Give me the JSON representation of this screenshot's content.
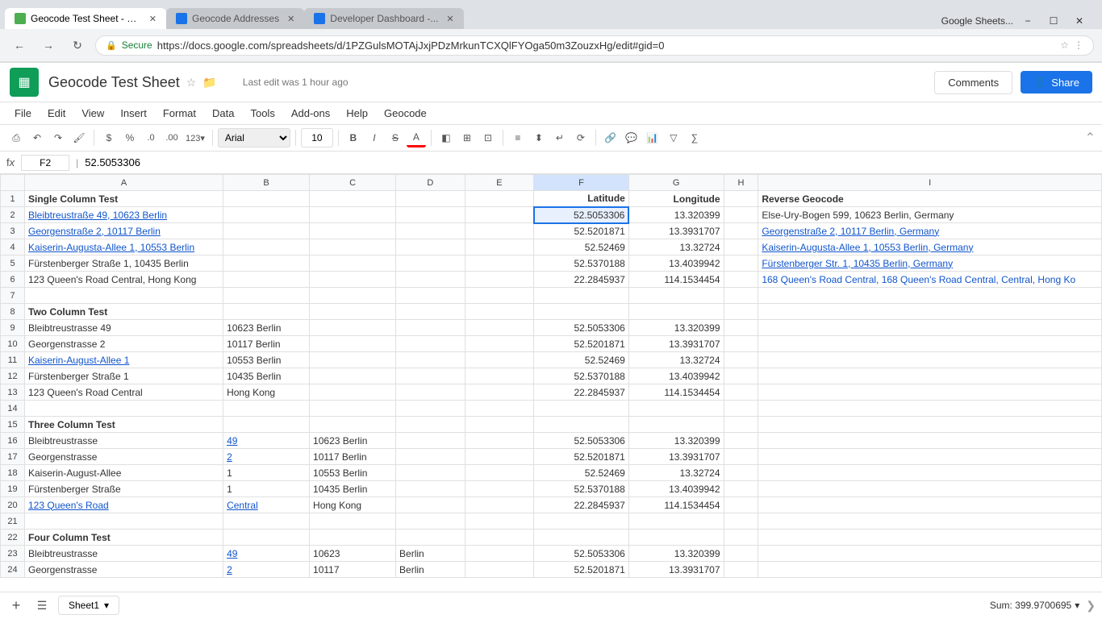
{
  "browser": {
    "tabs": [
      {
        "id": "tab1",
        "label": "Geocode Test Sheet - Go...",
        "favicon_color": "green",
        "active": true
      },
      {
        "id": "tab2",
        "label": "Geocode Addresses",
        "favicon_color": "blue",
        "active": false
      },
      {
        "id": "tab3",
        "label": "Developer Dashboard -...",
        "favicon_color": "blue",
        "active": false
      }
    ],
    "address": "https://docs.google.com/spreadsheets/d/1PZGulsMOTAjJxjPDzMrkunTCXQlFYOga50m3ZouzxHg/edit#gid=0",
    "secure_label": "Secure",
    "brand_label": "Google Sheets...",
    "window_controls": [
      "−",
      "☐",
      "✕"
    ]
  },
  "app": {
    "icon_char": "▦",
    "title": "Geocode Test Sheet",
    "last_edit": "Last edit was 1 hour ago",
    "comments_label": "Comments",
    "share_label": "Share"
  },
  "menu": {
    "items": [
      "File",
      "Edit",
      "View",
      "Insert",
      "Format",
      "Data",
      "Tools",
      "Add-ons",
      "Help",
      "Geocode"
    ]
  },
  "toolbar": {
    "print": "⎙",
    "undo": "↶",
    "redo": "↷",
    "paint": "🖌",
    "currency": "$",
    "percent": "%",
    "decimal_dec": ".0",
    "decimal_inc": ".00",
    "number_format": "123 ▾",
    "font_family": "Arial",
    "font_size": "10",
    "bold": "B",
    "italic": "I",
    "strikethrough": "S̶",
    "font_color": "A",
    "fill_color": "◧",
    "borders": "⊞",
    "merge": "⊡",
    "align_h": "≡",
    "align_v": "⬍",
    "text_wrap": "↵",
    "text_rotate": "⟳",
    "link": "🔗",
    "comment": "💬",
    "chart": "📊",
    "filter": "▽",
    "function": "∑",
    "collapse": "⌃"
  },
  "formula_bar": {
    "cell_ref": "F2",
    "value": "52.5053306"
  },
  "columns": {
    "headers": [
      "",
      "A",
      "B",
      "C",
      "D",
      "E",
      "F",
      "G",
      "H",
      "I"
    ]
  },
  "rows": [
    {
      "row": 1,
      "a": "Single Column Test",
      "b": "",
      "c": "",
      "d": "",
      "e": "",
      "f": "Latitude",
      "g": "Longitude",
      "h": "",
      "i": "Reverse Geocode",
      "bold": true
    },
    {
      "row": 2,
      "a": "Bleibtreustraße 49, 10623 Berlin",
      "b": "",
      "c": "",
      "d": "",
      "e": "",
      "f": "52.5053306",
      "g": "13.320399",
      "h": "",
      "i": "Else-Ury-Bogen 599, 10623 Berlin, Germany",
      "a_blue": true,
      "selected_f": true
    },
    {
      "row": 3,
      "a": "Georgenstraße 2, 10117 Berlin",
      "b": "",
      "c": "",
      "d": "",
      "e": "",
      "f": "52.5201871",
      "g": "13.3931707",
      "h": "",
      "i": "Georgenstraße 2, 10117 Berlin, Germany",
      "a_blue": true,
      "i_blue": true
    },
    {
      "row": 4,
      "a": "Kaiserin-Augusta-Allee 1, 10553 Berlin",
      "b": "",
      "c": "",
      "d": "",
      "e": "",
      "f": "52.52469",
      "g": "13.32724",
      "h": "",
      "i": "Kaiserin-Augusta-Allee 1, 10553 Berlin, Germany",
      "a_blue": true,
      "i_blue": true
    },
    {
      "row": 5,
      "a": "Fürstenberger Straße 1, 10435 Berlin",
      "b": "",
      "c": "",
      "d": "",
      "e": "",
      "f": "52.5370188",
      "g": "13.4039942",
      "h": "",
      "i": "Fürstenberger Str. 1, 10435 Berlin, Germany",
      "i_blue": true
    },
    {
      "row": 6,
      "a": "123 Queen's Road Central, Hong Kong",
      "b": "",
      "c": "",
      "d": "",
      "e": "",
      "f": "22.2845937",
      "g": "114.1534454",
      "h": "",
      "i": "168 Queen's Road Central, 168 Queen's Road Central, Central, Hong Ko"
    },
    {
      "row": 7,
      "a": "",
      "b": "",
      "c": "",
      "d": "",
      "e": "",
      "f": "",
      "g": "",
      "h": "",
      "i": ""
    },
    {
      "row": 8,
      "a": "Two Column Test",
      "b": "",
      "c": "",
      "d": "",
      "e": "",
      "f": "",
      "g": "",
      "h": "",
      "i": "",
      "bold": true
    },
    {
      "row": 9,
      "a": "Bleibtreustrasse 49",
      "b": "10623 Berlin",
      "c": "",
      "d": "",
      "e": "",
      "f": "52.5053306",
      "g": "13.320399",
      "h": "",
      "i": ""
    },
    {
      "row": 10,
      "a": "Georgenstrasse 2",
      "b": "10117 Berlin",
      "c": "",
      "d": "",
      "e": "",
      "f": "52.5201871",
      "g": "13.3931707",
      "h": "",
      "i": ""
    },
    {
      "row": 11,
      "a": "Kaiserin-August-Allee 1",
      "b": "10553 Berlin",
      "c": "",
      "d": "",
      "e": "",
      "f": "52.52469",
      "g": "13.32724",
      "h": "",
      "i": "",
      "a_blue": true
    },
    {
      "row": 12,
      "a": "Fürstenberger Straße 1",
      "b": "10435 Berlin",
      "c": "",
      "d": "",
      "e": "",
      "f": "52.5370188",
      "g": "13.4039942",
      "h": "",
      "i": ""
    },
    {
      "row": 13,
      "a": "123 Queen's Road Central",
      "b": "Hong Kong",
      "c": "",
      "d": "",
      "e": "",
      "f": "22.2845937",
      "g": "114.1534454",
      "h": "",
      "i": ""
    },
    {
      "row": 14,
      "a": "",
      "b": "",
      "c": "",
      "d": "",
      "e": "",
      "f": "",
      "g": "",
      "h": "",
      "i": ""
    },
    {
      "row": 15,
      "a": "Three Column Test",
      "b": "",
      "c": "",
      "d": "",
      "e": "",
      "f": "",
      "g": "",
      "h": "",
      "i": "",
      "bold": true
    },
    {
      "row": 16,
      "a": "Bleibtreustrasse",
      "b": "49",
      "c": "10623 Berlin",
      "d": "",
      "e": "",
      "f": "52.5053306",
      "g": "13.320399",
      "h": "",
      "i": "",
      "b_blue": true
    },
    {
      "row": 17,
      "a": "Georgenstrasse",
      "b": "2",
      "c": "10117 Berlin",
      "d": "",
      "e": "",
      "f": "52.5201871",
      "g": "13.3931707",
      "h": "",
      "i": "",
      "b_blue": true
    },
    {
      "row": 18,
      "a": "Kaiserin-August-Allee",
      "b": "1",
      "c": "10553 Berlin",
      "d": "",
      "e": "",
      "f": "52.52469",
      "g": "13.32724",
      "h": "",
      "i": ""
    },
    {
      "row": 19,
      "a": "Fürstenberger Straße",
      "b": "1",
      "c": "10435 Berlin",
      "d": "",
      "e": "",
      "f": "52.5370188",
      "g": "13.4039942",
      "h": "",
      "i": ""
    },
    {
      "row": 20,
      "a": "123 Queen's Road",
      "b": "Central",
      "c": "Hong Kong",
      "d": "",
      "e": "",
      "f": "22.2845937",
      "g": "114.1534454",
      "h": "",
      "i": "",
      "a_blue": true,
      "b_blue": true
    },
    {
      "row": 21,
      "a": "",
      "b": "",
      "c": "",
      "d": "",
      "e": "",
      "f": "",
      "g": "",
      "h": "",
      "i": ""
    },
    {
      "row": 22,
      "a": "Four Column Test",
      "b": "",
      "c": "",
      "d": "",
      "e": "",
      "f": "",
      "g": "",
      "h": "",
      "i": "",
      "bold": true
    },
    {
      "row": 23,
      "a": "Bleibtreustrasse",
      "b": "49",
      "c": "10623",
      "d": "Berlin",
      "e": "",
      "f": "52.5053306",
      "g": "13.320399",
      "h": "",
      "i": "",
      "b_blue": true
    },
    {
      "row": 24,
      "a": "Georgenstrasse",
      "b": "2",
      "c": "10117",
      "d": "Berlin",
      "e": "",
      "f": "52.5201871",
      "g": "13.3931707",
      "h": "",
      "i": "",
      "b_blue": true
    }
  ],
  "bottom": {
    "add_sheet": "+",
    "sheet_menu": "☰",
    "sheet_name": "Sheet1",
    "sum_label": "Sum: 399.9700695",
    "scroll_right": "❯"
  }
}
